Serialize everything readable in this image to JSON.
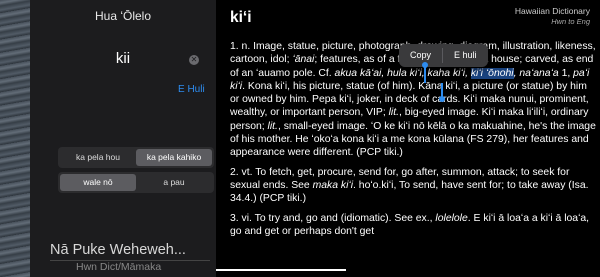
{
  "sidebar": {
    "title": "Hua ʻŌlelo",
    "search": {
      "value": "kii"
    },
    "e_huli_link": "E Huli",
    "segment1": [
      "ka pela hou",
      "ka pela kahiko"
    ],
    "segment1_selected": 1,
    "segment2": [
      "wale nō",
      "a pau"
    ],
    "segment2_selected": 0,
    "bottom_title": "Nā Puke Weheweh...",
    "bottom_subtitle": "Hwn Dict/Māmaka"
  },
  "entry": {
    "word": "kiʻi",
    "dict_title": "Hawaiian Dictionary",
    "dict_subtitle": "Hwn to Eng",
    "def1": {
      "a": "1. n. Image, statue, picture, photograph, drawing, diagram, illustration, likeness, cartoon, idol; ",
      "b": "ʻānai",
      "c": "; features, as of a face; plans, as for a house; carved, as end of an ʻauamo pole. Cf. ",
      "d": "akua kāʻai, hula kiʻi, kaha kiʻi, ",
      "sel": "kiʻi ʻōnohi",
      "e": ", naʻanaʻa",
      "f": " 1, ",
      "g": "paʻi kiʻi",
      "h": ". Kona kiʻi, his picture, statue (of him). Kāna kiʻi, a picture (or statue) by him or owned by him. Pepa kiʻi, joker, in deck of cards. Kiʻi maka nunui, prominent, wealthy, or important person, VIP; ",
      "lit1": "lit.",
      "i": ", big-eyed image. Kiʻi maka liʻiliʻi, ordinary person; ",
      "lit2": "lit.",
      "j": ", small-eyed image. ʻO ke kiʻi nō kēlā o ka makuahine, he's the image of his mother. He ʻokoʻa kona kiʻi a me kona kūlana (FS 279), her features and appearance were different. (PCP tiki.)"
    },
    "def2": {
      "a": "2. vt. To fetch, get, procure, send for, go after, summon, attack; to seek for sexual ends. See ",
      "b": "maka kiʻi",
      "c": ". hoʻo.kiʻi, To send, have sent for; to take away (Isa. 34.4.) (PCP tiki.)"
    },
    "def3": {
      "a": "3. vi. To try and, go and (idiomatic). See ex., ",
      "b": "lolelole",
      "c": ". E kiʻi ā loaʻa a kiʻi ā loaʻa, go and get or perhaps don't get"
    }
  },
  "context_menu": {
    "copy": "Copy",
    "lookup": "E huli"
  },
  "colors": {
    "accent": "#2d8cf0",
    "selection": "#2d78e6"
  }
}
